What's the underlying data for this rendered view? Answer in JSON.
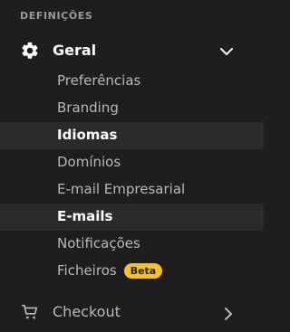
{
  "section": {
    "title": "DEFINIÇÕES"
  },
  "group": {
    "label": "Geral",
    "icon": "gear-icon",
    "expanded": true,
    "items": [
      {
        "label": "Preferências",
        "active": false
      },
      {
        "label": "Branding",
        "active": false
      },
      {
        "label": "Idiomas",
        "active": true
      },
      {
        "label": "Domínios",
        "active": false
      },
      {
        "label": "E-mail Empresarial",
        "active": false
      },
      {
        "label": "E-mails",
        "active": true
      },
      {
        "label": "Notificações",
        "active": false
      },
      {
        "label": "Ficheiros",
        "active": false,
        "badge": "Beta"
      }
    ]
  },
  "checkout": {
    "label": "Checkout",
    "icon": "cart-icon"
  },
  "colors": {
    "background": "#1e1e1e",
    "highlight": "#2b2b2b",
    "badge": "#f5c518"
  }
}
